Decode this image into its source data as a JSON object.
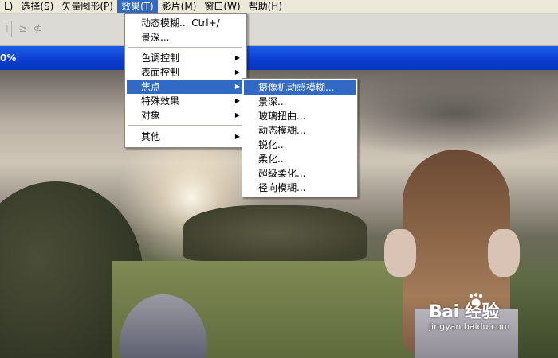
{
  "menubar": {
    "items": [
      {
        "label": "L)"
      },
      {
        "label": "选择(S)"
      },
      {
        "label": "矢量图形(P)"
      },
      {
        "label": "效果(T)"
      },
      {
        "label": "影片(M)"
      },
      {
        "label": "窗口(W)"
      },
      {
        "label": "帮助(H)"
      }
    ]
  },
  "toolbar": {
    "buttons": [
      "tool-a-icon",
      "tool-b-icon",
      "tool-c-icon"
    ]
  },
  "document": {
    "title_fragment": "0%"
  },
  "effects_menu": {
    "items": [
      {
        "label": "动态模糊... Ctrl+/"
      },
      {
        "label": "景深..."
      },
      {
        "label": "色调控制",
        "submenu": true
      },
      {
        "label": "表面控制",
        "submenu": true
      },
      {
        "label": "焦点",
        "submenu": true
      },
      {
        "label": "特殊效果",
        "submenu": true
      },
      {
        "label": "对象",
        "submenu": true
      },
      {
        "label": "其他",
        "submenu": true
      }
    ]
  },
  "focus_submenu": {
    "items": [
      {
        "label": "摄像机动感模糊..."
      },
      {
        "label": "景深..."
      },
      {
        "label": "玻璃扭曲..."
      },
      {
        "label": "动态模糊..."
      },
      {
        "label": "锐化..."
      },
      {
        "label": "柔化..."
      },
      {
        "label": "超级柔化..."
      },
      {
        "label": "径向模糊..."
      }
    ]
  },
  "watermark": {
    "logo": "Bai 经验",
    "url": "jingyan.baidu.com"
  },
  "colors": {
    "highlight": "#316ac5",
    "titlebar": "#0a3cd0",
    "menubar": "#ece9d8"
  }
}
